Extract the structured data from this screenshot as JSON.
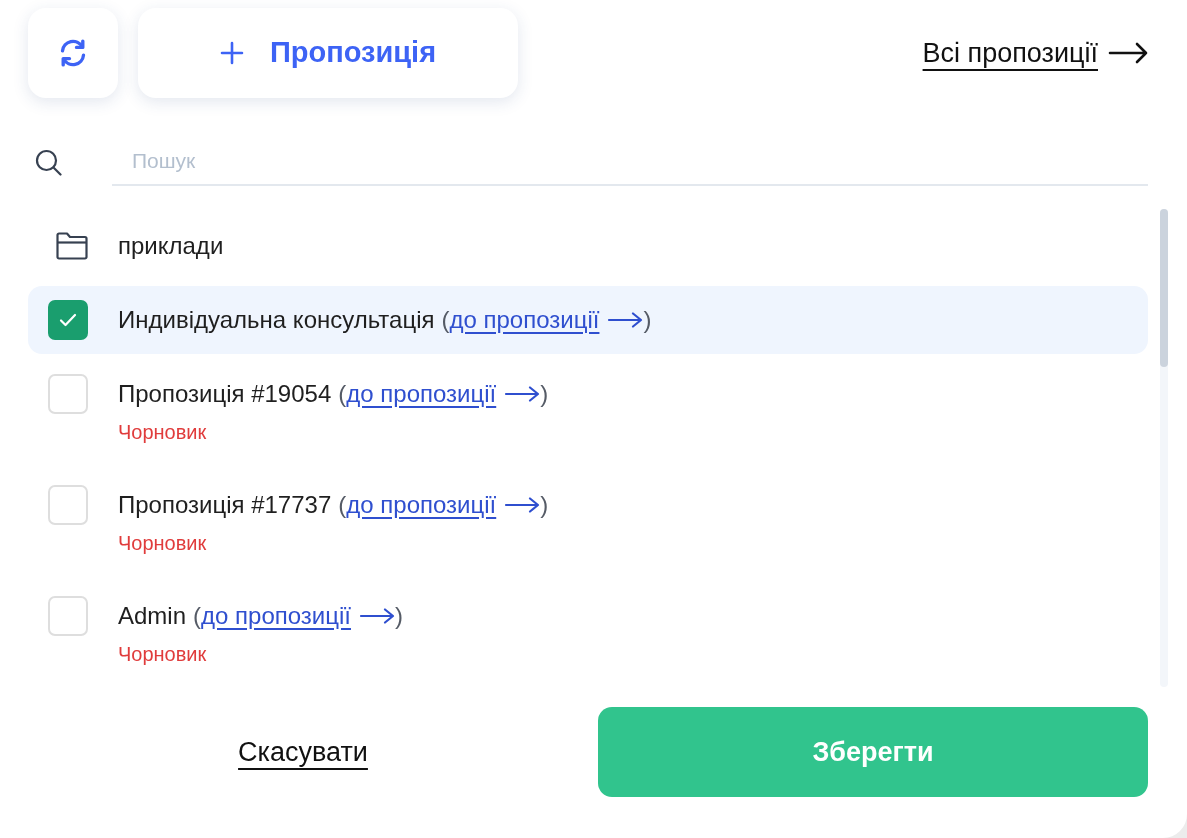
{
  "header": {
    "new_button": {
      "label": "Пропозиція"
    },
    "all_link": {
      "label": "Всі пропозиції"
    }
  },
  "search": {
    "placeholder": "Пошук"
  },
  "items": [
    {
      "kind": "folder",
      "label": "приклади"
    },
    {
      "kind": "proposal",
      "title": "Индивідуальна консультація",
      "open": "(",
      "link": "до пропозиції",
      "close": ")",
      "checked": true
    },
    {
      "kind": "proposal",
      "title": "Пропозиція #19054",
      "open": "(",
      "link": "до пропозиції",
      "close": ")",
      "checked": false,
      "status": "Чорновик"
    },
    {
      "kind": "proposal",
      "title": "Пропозиція #17737",
      "open": "(",
      "link": "до пропозиції",
      "close": ")",
      "checked": false,
      "status": "Чорновик"
    },
    {
      "kind": "proposal",
      "title": "Admin",
      "open": "(",
      "link": "до пропозиції",
      "close": ")",
      "checked": false,
      "status": "Чорновик"
    }
  ],
  "footer": {
    "cancel": "Скасувати",
    "save": "Зберегти"
  }
}
